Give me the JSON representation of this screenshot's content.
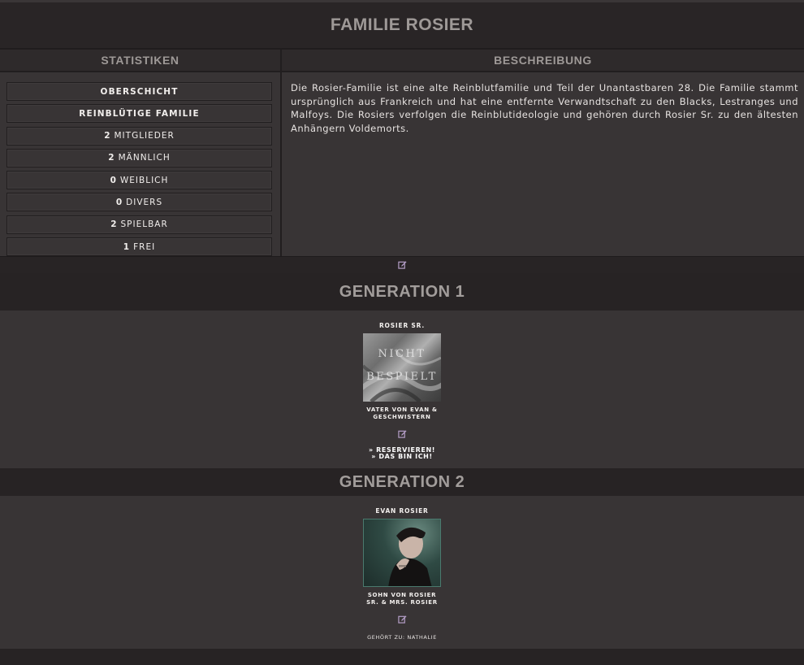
{
  "page": {
    "title": "FAMILIE ROSIER"
  },
  "stats_panel": {
    "heading": "STATISTIKEN",
    "items": [
      {
        "num": "",
        "label": "OBERSCHICHT"
      },
      {
        "num": "",
        "label": "REINBLÜTIGE FAMILIE"
      },
      {
        "num": "2",
        "label": "MITGLIEDER"
      },
      {
        "num": "2",
        "label": "MÄNNLICH"
      },
      {
        "num": "0",
        "label": "WEIBLICH"
      },
      {
        "num": "0",
        "label": "DIVERS"
      },
      {
        "num": "2",
        "label": "SPIELBAR"
      },
      {
        "num": "1",
        "label": "FREI"
      }
    ]
  },
  "description_panel": {
    "heading": "BESCHREIBUNG",
    "text": "Die Rosier-Familie ist eine alte Reinblutfamilie und Teil der Unantastbaren 28. Die Familie stammt ursprünglich aus Frankreich und hat eine entfernte Verwandtschaft zu den Blacks, Lestranges und Malfoys. Die Rosiers verfolgen die Reinblutideologie und gehören durch Rosier Sr. zu den ältesten Anhängern Voldemorts."
  },
  "edit_icon": "edit-icon",
  "generations": [
    {
      "title": "GENERATION 1",
      "member": {
        "name": "ROSIER SR.",
        "avatar_text_1": "NICHT",
        "avatar_text_2": "BESPIELT",
        "relation_1": "VATER VON EVAN &",
        "relation_2": "GESCHWISTERN",
        "link_reserve": "» RESERVIEREN!",
        "link_claim": "» DAS BIN ICH!"
      }
    },
    {
      "title": "GENERATION 2",
      "member": {
        "name": "EVAN ROSIER",
        "relation_1": "SOHN VON ROSIER",
        "relation_2": "SR. & MRS. ROSIER",
        "owner": "GEHÖRT ZU: NATHALIE"
      }
    }
  ],
  "colors": {
    "accent_icon": "#b59fc8",
    "background": "#383435",
    "header": "#272324"
  }
}
